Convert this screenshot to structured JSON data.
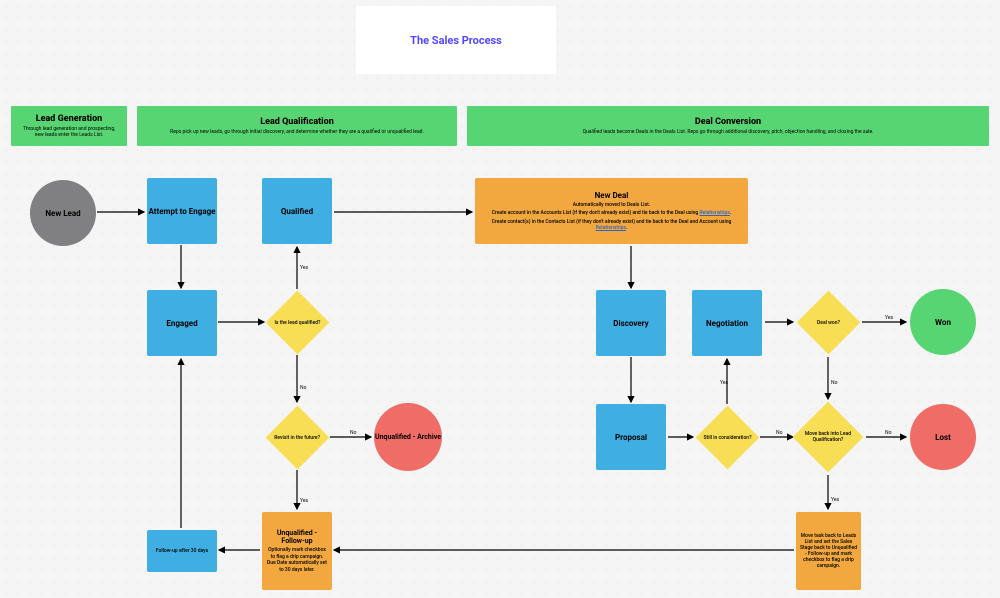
{
  "title": "The Sales Process",
  "lanes": {
    "gen": {
      "title": "Lead Generation",
      "desc": "Through lead generation and prospecting, new leads enter the Leads List."
    },
    "qual": {
      "title": "Lead Qualification",
      "desc": "Reps pick up new leads, go through initial discovery, and determine whether they are a qualified or unqualified lead."
    },
    "conv": {
      "title": "Deal Conversion",
      "desc": "Qualified leads become Deals in the Deals List. Reps go through additional discovery, pitch, objection handling, and closing the sale."
    }
  },
  "nodes": {
    "new_lead": "New Lead",
    "attempt": "Attempt to Engage",
    "engaged": "Engaged",
    "qualified": "Qualified",
    "is_qualified": "Is the lead qualified?",
    "revisit": "Revisit in the future?",
    "archive": "Unqualified - Archive",
    "followup": {
      "title": "Unqualified - Follow-up",
      "desc": "Optionally mark checkbox to flag a drip campaign. Due Date automatically set to 30 days later."
    },
    "followup30": "Follow-up after 30 days",
    "new_deal": {
      "title": "New Deal",
      "desc1": "Automatically moved to Deals List.",
      "desc2a": "Create account in the Accounts List (if they don't already exist) and tie back to the Deal using ",
      "link": "Relationships",
      "desc2b": ".",
      "desc3a": "Create contact(s) in the Contacts List (if they don't already exist) and tie back to the Deal and Account using ",
      "desc3b": "."
    },
    "discovery": "Discovery",
    "proposal": "Proposal",
    "negotiation": "Negotiation",
    "still": "Still in consideration?",
    "deal_won": "Deal won?",
    "move_back": "Move back into Lead Qualification?",
    "won": "Won",
    "lost": "Lost",
    "move_task": "Move task back to Leads List and set the Sales Stage back to Unqualified - Follow-up and mark checkbox to flag a drip campaign."
  },
  "labels": {
    "yes": "Yes",
    "no": "No"
  }
}
